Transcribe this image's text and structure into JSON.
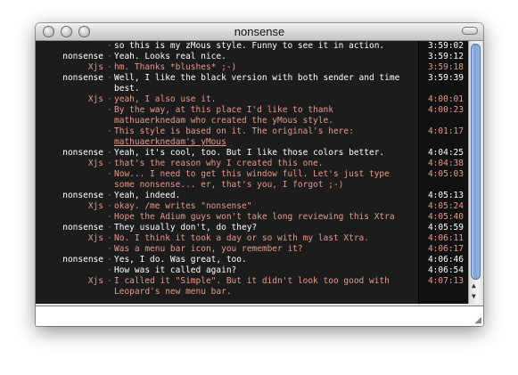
{
  "window": {
    "title": "nonsense"
  },
  "log": [
    {
      "sender": "",
      "message": "so this is my zMous style. Funny to see it in action.",
      "time": "3:59:02",
      "who": "me"
    },
    {
      "sender": "nonsense",
      "message": "Yeah. Looks real nice.",
      "time": "3:59:12",
      "who": "me"
    },
    {
      "sender": "Xjs",
      "message": "hm. Thanks *blushes* ;-)",
      "time": "3:59:18",
      "who": "other"
    },
    {
      "sender": "nonsense",
      "message": "Well, I like the black version with both sender and time\nbest.",
      "time": "3:59:39",
      "who": "me"
    },
    {
      "sender": "Xjs",
      "message": "yeah, I also use it.",
      "time": "4:00:01",
      "who": "other"
    },
    {
      "sender": "",
      "message": "By the way, at this place I'd like to thank\nmathuaerknedam who created the yMous style.",
      "time": "4:00:23",
      "who": "other"
    },
    {
      "sender": "",
      "message": "This style is based on it. The original's here:",
      "link": "mathuaerknedam's yMous",
      "time": "4:01:17",
      "who": "other"
    },
    {
      "sender": "nonsense",
      "message": "Yeah, it's cool, too. But I like those colors better.",
      "time": "4:04:25",
      "who": "me"
    },
    {
      "sender": "Xjs",
      "message": "that's the reason why I created this one.",
      "time": "4:04:38",
      "who": "other"
    },
    {
      "sender": "",
      "message": "Now... I need to get this window full. Let's just type\nsome nonsense... er, that's you, I forgot ;-)",
      "time": "4:05:03",
      "who": "other"
    },
    {
      "sender": "nonsense",
      "message": "Yeah, indeed.",
      "time": "4:05:13",
      "who": "me"
    },
    {
      "sender": "Xjs",
      "message": "okay. /me writes \"nonsense\"",
      "time": "4:05:24",
      "who": "other"
    },
    {
      "sender": "",
      "message": "Hope the Adium guys won't take long reviewing this Xtra",
      "time": "4:05:40",
      "who": "other"
    },
    {
      "sender": "nonsense",
      "message": "They usually don't, do they?",
      "time": "4:05:59",
      "who": "me"
    },
    {
      "sender": "Xjs",
      "message": "No. I think it took a day or so with my last Xtra.",
      "time": "4:06:11",
      "who": "other"
    },
    {
      "sender": "",
      "message": "Was a menu bar icon, you remember it?",
      "time": "4:06:17",
      "who": "other"
    },
    {
      "sender": "nonsense",
      "message": "Yes, I do. Was great, too.",
      "time": "4:06:46",
      "who": "me"
    },
    {
      "sender": "",
      "message": "How was it called again?",
      "time": "4:06:54",
      "who": "me"
    },
    {
      "sender": "Xjs",
      "message": "I called it \"Simple\". But it didn't look too good with\nLeopard's new menu bar.",
      "time": "4:07:13",
      "who": "other"
    }
  ],
  "input": {
    "value": ""
  }
}
